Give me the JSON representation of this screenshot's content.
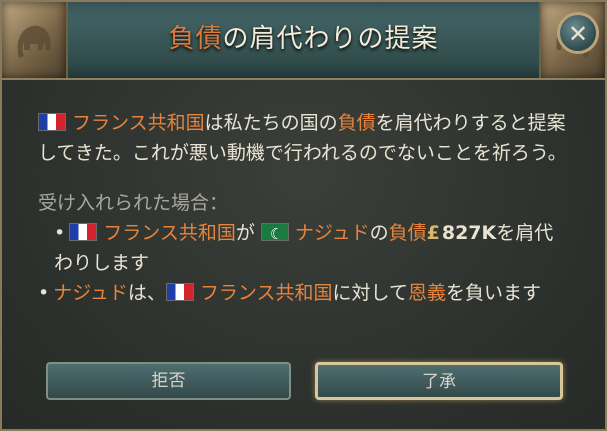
{
  "dialog": {
    "title_part1": "負債",
    "title_part2": "の肩代わりの提案",
    "close_glyph": "✕",
    "message": {
      "country": "フランス共和国",
      "text1": "は私たちの国の",
      "debt_word": "負債",
      "text2": "を肩代わりすると提案してきた。これが悪い動機で行われるのでないことを祈ろう。"
    },
    "if_accepted_label": "受け入れられた場合：",
    "bullet1": {
      "country": "フランス共和国",
      "particle": "が",
      "target": "ナジュド",
      "no": "の",
      "debt_word": "負債",
      "amount": "827K",
      "rest": "を肩代わりします"
    },
    "bullet2": {
      "target": "ナジュド",
      "text1": "は、",
      "country": "フランス共和国",
      "text2": "に対して",
      "favor_word": "恩義",
      "text3": "を負います"
    },
    "buttons": {
      "reject": "拒否",
      "accept": "了承"
    }
  }
}
